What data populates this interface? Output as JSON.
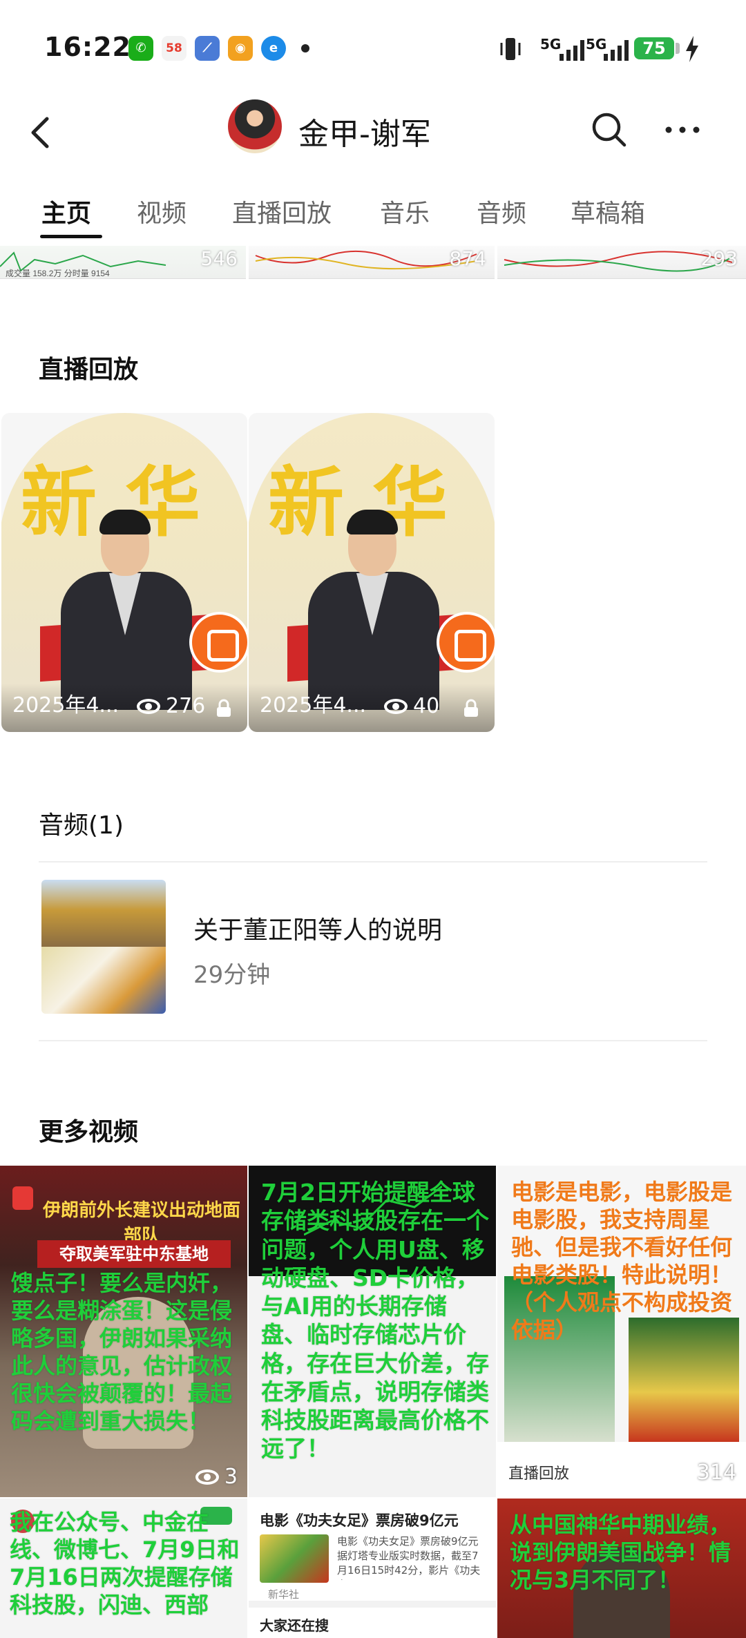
{
  "status_bar": {
    "time": "16:22",
    "app_icons": [
      {
        "name": "wechat-icon",
        "color": "#1aad19",
        "glyph": "✆"
      },
      {
        "name": "58-icon",
        "color": "#f4f4f4",
        "glyph": "58"
      },
      {
        "name": "stock-icon",
        "color": "#4a7bd6",
        "glyph": "⟋"
      },
      {
        "name": "weibo-icon",
        "color": "#f2a11f",
        "glyph": "◉"
      },
      {
        "name": "browser-icon",
        "color": "#1c8be8",
        "glyph": "e"
      }
    ],
    "network_1": "5G",
    "network_2": "5G",
    "battery": "75"
  },
  "header": {
    "title": "金甲-谢军"
  },
  "tabs": [
    {
      "label": "主页",
      "active": true
    },
    {
      "label": "视频",
      "active": false
    },
    {
      "label": "直播回放",
      "active": false
    },
    {
      "label": "音乐",
      "active": false
    },
    {
      "label": "音频",
      "active": false
    },
    {
      "label": "草稿箱",
      "active": false
    }
  ],
  "top_strip": [
    {
      "views": "546"
    },
    {
      "views": "874"
    },
    {
      "views": "293"
    }
  ],
  "live_section": {
    "title": "直播回放",
    "items": [
      {
        "date": "2025年4...",
        "views": "276"
      },
      {
        "date": "2025年4...",
        "views": "40"
      }
    ]
  },
  "audio_section": {
    "title": "音频(1)",
    "item": {
      "title": "关于董正阳等人的说明",
      "duration": "29分钟"
    }
  },
  "more_section": {
    "title": "更多视频",
    "cells": [
      {
        "headline": "伊朗前外长建议出动地面部队",
        "subheadline": "夺取美军驻中东基地",
        "overlay": "馊点子！要么是内奸，要么是糊涂蛋！这是侵略多国，伊朗如果采纳此人的意见，估计政权很快会被颠覆的！最起码会遭到重大损失！",
        "views": "3"
      },
      {
        "overlay": "7月2日开始提醒全球存储类科技股存在一个问题，个人用U盘、移动硬盘、SD卡价格，与AI用的长期存储盘、临时存储芯片价格，存在巨大价差，存在矛盾点，说明存储类科技股距离最高价格不远了！"
      },
      {
        "overlay": "电影是电影，电影股是电影股，我支持周星驰、但是我不看好任何电影类股！特此说明！（个人观点不构成投资依据）",
        "views": "314",
        "caption": "直播回放"
      },
      {
        "overlay": "我在公众号、中金在线、微博七、7月9日和7月16日两次提醒存储科技股，闪迪、西部"
      },
      {
        "news_title": "电影《功夫女足》票房破9亿元",
        "news_body": "电影《功夫女足》票房破9亿元 据灯塔专业版实时数据，截至7月16日15时42分，影片《功夫女…",
        "source": "新华社",
        "footer": "大家还在搜"
      },
      {
        "overlay": "从中国神华中期业绩，说到伊朗美国战争！情况与3月不同了！"
      }
    ]
  },
  "colors": {
    "accent_green": "#1fcf3a",
    "overlay_orange": "#f07a1a",
    "battery_green": "#2bb34a"
  }
}
